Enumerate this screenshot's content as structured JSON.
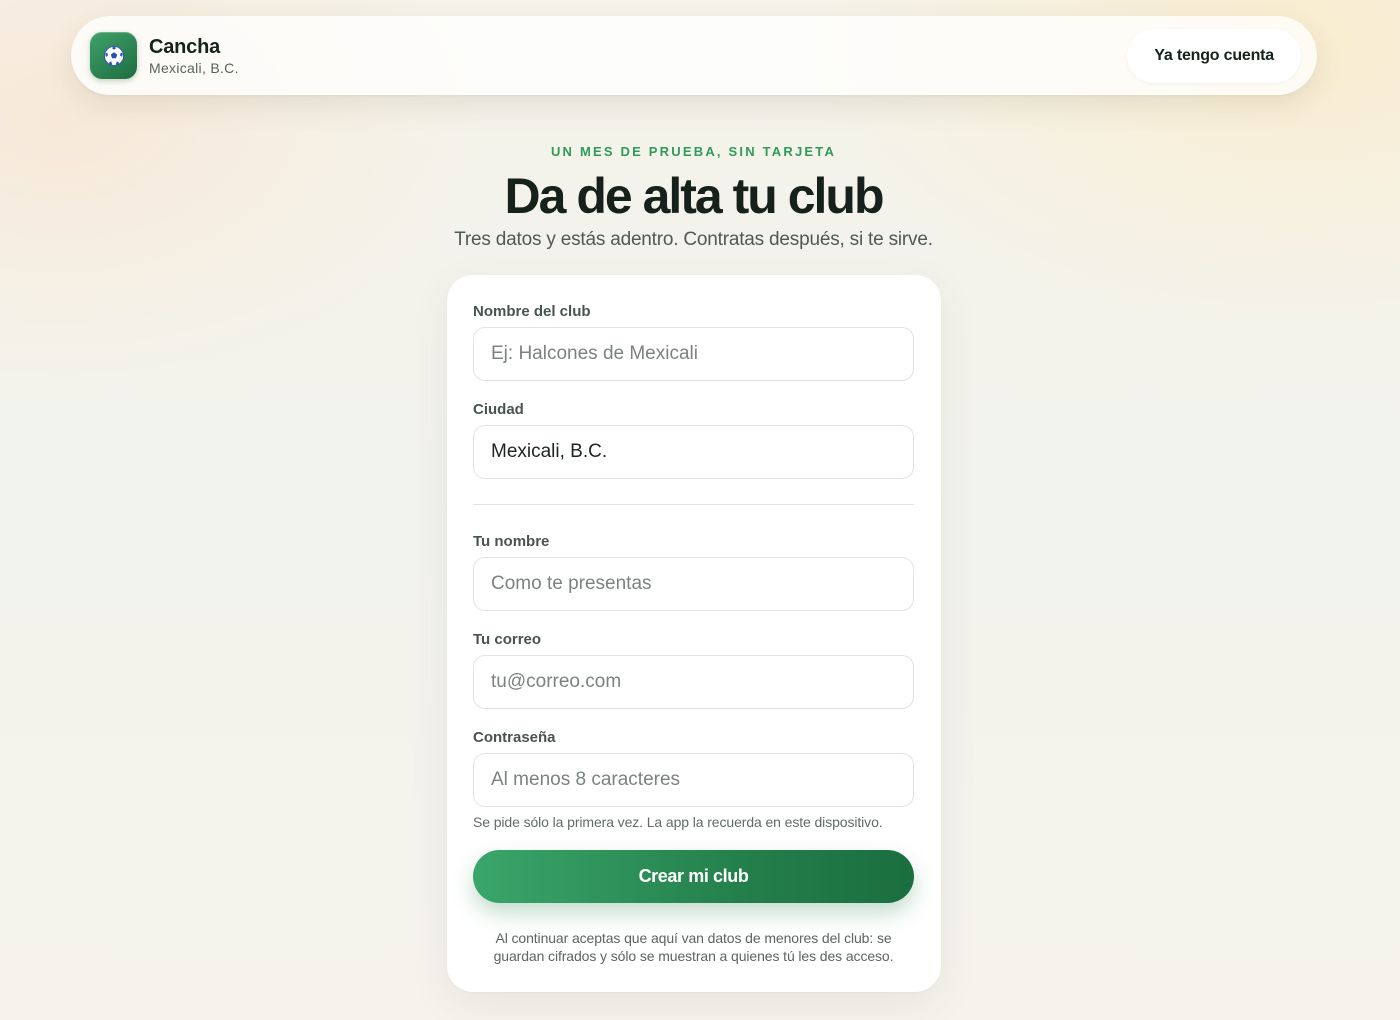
{
  "header": {
    "brand_name": "Cancha",
    "brand_city": "Mexicali, B.C.",
    "logo_icon": "soccer-ball-icon",
    "login_label": "Ya tengo cuenta"
  },
  "hero": {
    "eyebrow": "UN MES DE PRUEBA, SIN TARJETA",
    "title": "Da de alta tu club",
    "subtitle": "Tres datos y estás adentro. Contratas después, si te sirve."
  },
  "form": {
    "club_name": {
      "label": "Nombre del club",
      "placeholder": "Ej: Halcones de Mexicali",
      "value": ""
    },
    "city": {
      "label": "Ciudad",
      "placeholder": "",
      "value": "Mexicali, B.C."
    },
    "your_name": {
      "label": "Tu nombre",
      "placeholder": "Como te presentas",
      "value": ""
    },
    "email": {
      "label": "Tu correo",
      "placeholder": "tu@correo.com",
      "value": ""
    },
    "password": {
      "label": "Contraseña",
      "placeholder": "Al menos 8 caracteres",
      "value": ""
    },
    "password_hint": "Se pide sólo la primera vez. La app la recuerda en este dispositivo.",
    "submit_label": "Crear mi club",
    "legal_text": "Al continuar aceptas que aquí van datos de menores del club: se guardan cifrados y sólo se muestran a quienes tú les des acceso."
  },
  "colors": {
    "accent": "#2f9a5c",
    "button_start": "#3aa66a",
    "button_end": "#1a6e3f",
    "text_dark": "#16211b"
  }
}
